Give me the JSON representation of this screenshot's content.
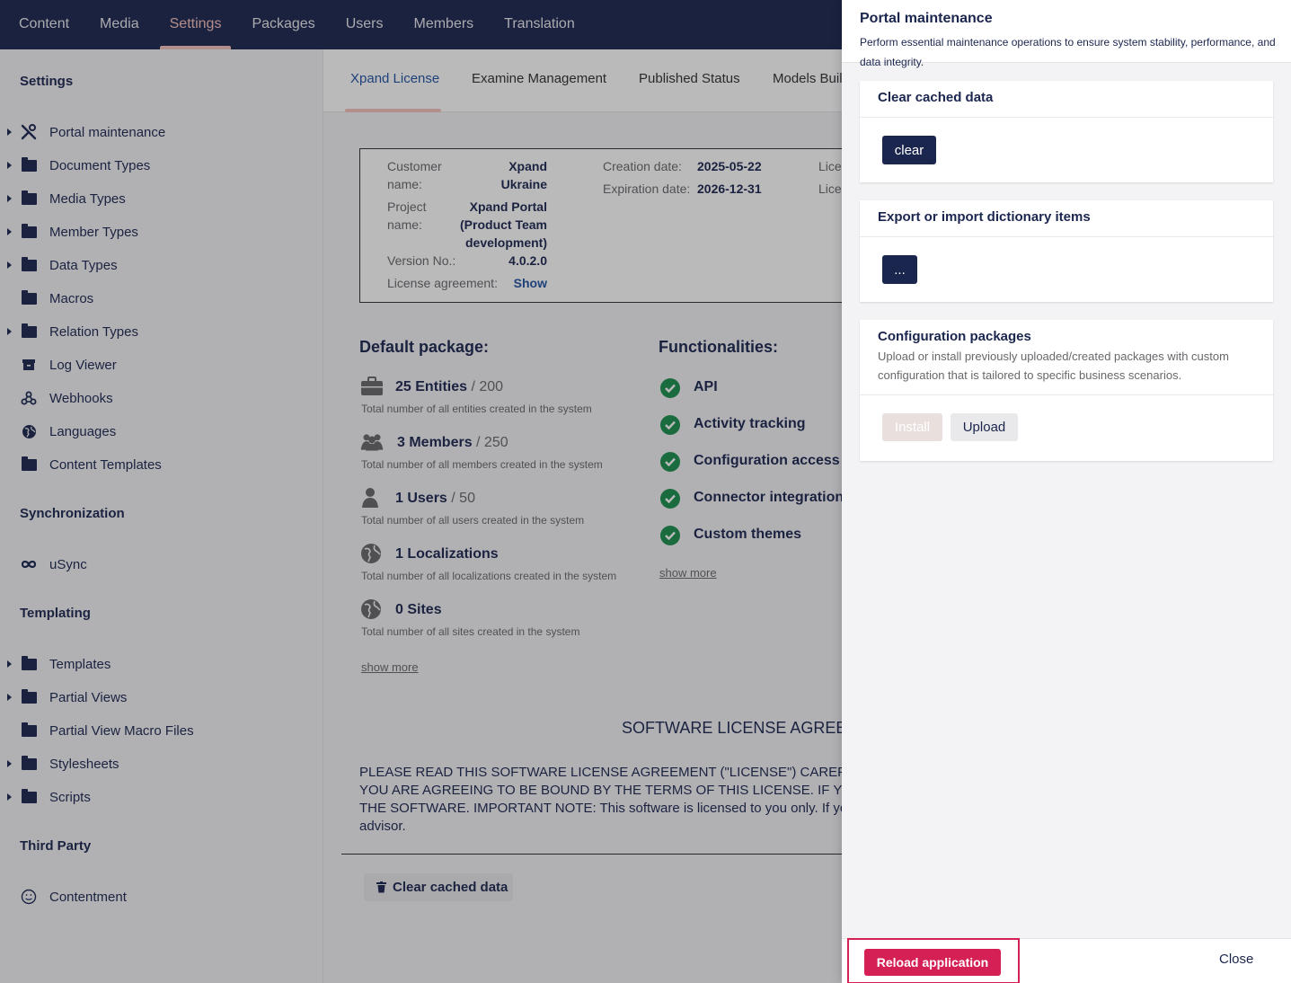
{
  "nav": {
    "items": [
      "Content",
      "Media",
      "Settings",
      "Packages",
      "Users",
      "Members",
      "Translation"
    ],
    "active": "Settings"
  },
  "sidebar": {
    "sections": {
      "settings": "Settings",
      "synchronization": "Synchronization",
      "templating": "Templating",
      "third_party": "Third Party"
    },
    "settings_items": [
      {
        "label": "Portal maintenance",
        "icon": "wrench-screwdriver-icon",
        "caret": true
      },
      {
        "label": "Document Types",
        "icon": "folder-icon",
        "caret": true
      },
      {
        "label": "Media Types",
        "icon": "folder-icon",
        "caret": true
      },
      {
        "label": "Member Types",
        "icon": "folder-icon",
        "caret": true
      },
      {
        "label": "Data Types",
        "icon": "folder-icon",
        "caret": true
      },
      {
        "label": "Macros",
        "icon": "folder-icon",
        "caret": false
      },
      {
        "label": "Relation Types",
        "icon": "folder-icon",
        "caret": true
      },
      {
        "label": "Log Viewer",
        "icon": "archive-icon",
        "caret": false
      },
      {
        "label": "Webhooks",
        "icon": "webhook-icon",
        "caret": false
      },
      {
        "label": "Languages",
        "icon": "globe-icon",
        "caret": false
      },
      {
        "label": "Content Templates",
        "icon": "folder-icon",
        "caret": false
      }
    ],
    "sync_items": [
      {
        "label": "uSync",
        "icon": "infinity-icon"
      }
    ],
    "templating_items": [
      {
        "label": "Templates",
        "caret": true
      },
      {
        "label": "Partial Views",
        "caret": true
      },
      {
        "label": "Partial View Macro Files",
        "caret": false
      },
      {
        "label": "Stylesheets",
        "caret": true
      },
      {
        "label": "Scripts",
        "caret": true
      }
    ],
    "third_party_items": [
      {
        "label": "Contentment",
        "icon": "smiley-icon"
      }
    ]
  },
  "tabs": [
    "Xpand License",
    "Examine Management",
    "Published Status",
    "Models Buil"
  ],
  "license": {
    "customer_name_label_1": "Customer",
    "customer_name_label_2": "name:",
    "customer_name_1": "Xpand",
    "customer_name_2": "Ukraine",
    "project_name_label_1": "Project",
    "project_name_label_2": "name:",
    "project_name_1": "Xpand Portal",
    "project_name_2": "(Product Team",
    "project_name_3": "development)",
    "version_label": "Version No.:",
    "version": "4.0.2.0",
    "agreement_label": "License agreement:",
    "agreement_link": "Show",
    "creation_label": "Creation date:",
    "creation": "2025-05-22",
    "expiration_label": "Expiration date:",
    "expiration": "2026-12-31",
    "lic_1": "Lice",
    "lic_2": "Lice"
  },
  "default_package": {
    "title": "Default package:",
    "stats": [
      {
        "count": "25 Entities",
        "max": " / 200",
        "desc": "Total number of all entities created in the system",
        "icon": "briefcase-icon"
      },
      {
        "count": "3 Members",
        "max": " / 250",
        "desc": "Total number of all members created in the system",
        "icon": "users-icon"
      },
      {
        "count": "1 Users",
        "max": " / 50",
        "desc": "Total number of all users created in the system",
        "icon": "user-icon"
      },
      {
        "count": "1 Localizations",
        "max": "",
        "desc": "Total number of all localizations created in the system",
        "icon": "globe-icon"
      },
      {
        "count": "0 Sites",
        "max": "",
        "desc": "Total number of all sites created in the system",
        "icon": "globe-icon"
      }
    ],
    "show_more": "show more"
  },
  "functionalities": {
    "title": "Functionalities:",
    "items": [
      "API",
      "Activity tracking",
      "Configuration access",
      "Connector integration",
      "Custom themes"
    ],
    "show_more": "show more"
  },
  "agreement": {
    "title": "SOFTWARE LICENSE AGREE",
    "lines": [
      "PLEASE READ THIS SOFTWARE LICENSE AGREEMENT (\"LICENSE\") CAREFULLY",
      "YOU ARE AGREEING TO BE BOUND BY THE TERMS OF THIS LICENSE. IF YOU",
      "THE SOFTWARE. IMPORTANT NOTE: This software is licensed to you only. If you",
      "advisor."
    ]
  },
  "clear_cache_button": "Clear cached data",
  "panel": {
    "title": "Portal maintenance",
    "description": "Perform essential maintenance operations to ensure system stability, performance, and data integrity.",
    "cards": {
      "clear": {
        "title": "Clear cached data",
        "button": "clear"
      },
      "dictionary": {
        "title": "Export or import dictionary items",
        "button": "..."
      },
      "config": {
        "title": "Configuration packages",
        "subtitle": "Upload or install previously uploaded/created packages with custom configuration that is tailored to specific business scenarios.",
        "install": "Install",
        "upload": "Upload"
      }
    },
    "reload_button": "Reload application",
    "close_button": "Close"
  },
  "colors": {
    "navy": "#1b264f",
    "accent": "#f5c1bc",
    "danger": "#d42054",
    "success": "#1b8f4c",
    "link": "#2152a3"
  }
}
